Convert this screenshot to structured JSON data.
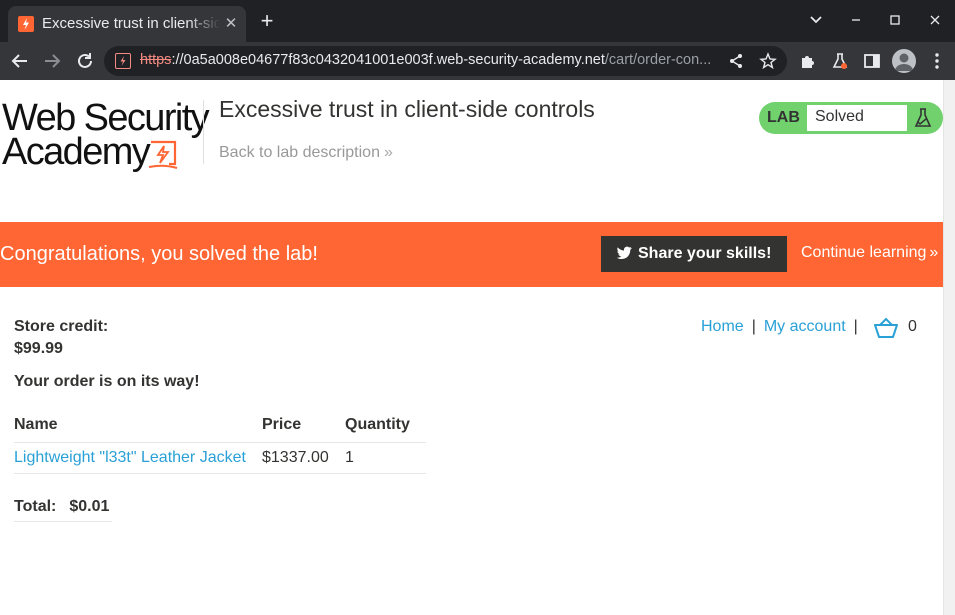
{
  "browser": {
    "tab_title": "Excessive trust in client-side controls",
    "url_scheme": "https",
    "url_host": "://0a5a008e04677f83c0432041001e003f.web-security-academy.net",
    "url_path": "/cart/order-con..."
  },
  "header": {
    "logo_line1": "Web Security",
    "logo_line2": "Academy",
    "lab_title": "Excessive trust in client-side controls",
    "back_link": "Back to lab description",
    "lab_tag": "LAB",
    "lab_status": "Solved",
    "accent_color": "#ff6633",
    "status_color": "#70d16d"
  },
  "banner": {
    "message": "Congratulations, you solved the lab!",
    "share_label": "Share your skills!",
    "continue_label": "Continue learning"
  },
  "nav": {
    "home": "Home",
    "separator": "|",
    "my_account": "My account",
    "cart_count": "0"
  },
  "account": {
    "store_credit_label": "Store credit:",
    "store_credit_value": "$99.99",
    "order_message": "Your order is on its way!"
  },
  "order_table": {
    "headers": [
      "Name",
      "Price",
      "Quantity"
    ],
    "rows": [
      {
        "name": "Lightweight \"l33t\" Leather Jacket",
        "price": "$1337.00",
        "quantity": "1"
      }
    ],
    "total_label": "Total:",
    "total_value": "$0.01"
  }
}
